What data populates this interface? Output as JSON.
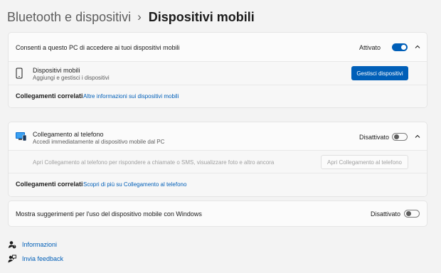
{
  "breadcrumb": {
    "parent": "Bluetooth e dispositivi",
    "separator": "›",
    "current": "Dispositivi mobili"
  },
  "card1": {
    "access": {
      "label": "Consenti a questo PC di accedere ai tuoi dispositivi mobili",
      "state": "Attivato",
      "toggle_on": true
    },
    "devices": {
      "title": "Dispositivi mobili",
      "subtitle": "Aggiungi e gestisci i dispositivi",
      "button": "Gestisci dispositivi",
      "icon": "phone-icon"
    },
    "related": {
      "label": "Collegamenti correlati",
      "link": "Altre informazioni sui dispositivi mobili"
    }
  },
  "card2": {
    "phone_link": {
      "title": "Collegamento al telefono",
      "subtitle": "Accedi immediatamente al dispositivo mobile dal PC",
      "state": "Disattivato",
      "toggle_on": false,
      "icon": "phone-link-icon"
    },
    "open": {
      "text": "Apri Collegamento al telefono per rispondere a chiamate o SMS, visualizzare foto e altro ancora",
      "button": "Apri Collegamento al telefono"
    },
    "related": {
      "label": "Collegamenti correlati",
      "link": "Scopri di più su Collegamento al telefono"
    }
  },
  "card3": {
    "label": "Mostra suggerimenti per l'uso del dispositivo mobile con Windows",
    "state": "Disattivato",
    "toggle_on": false
  },
  "footer": {
    "info": "Informazioni",
    "feedback": "Invia feedback"
  },
  "colors": {
    "accent": "#005fb8",
    "background": "#f3f3f3",
    "card": "#fbfbfb"
  }
}
